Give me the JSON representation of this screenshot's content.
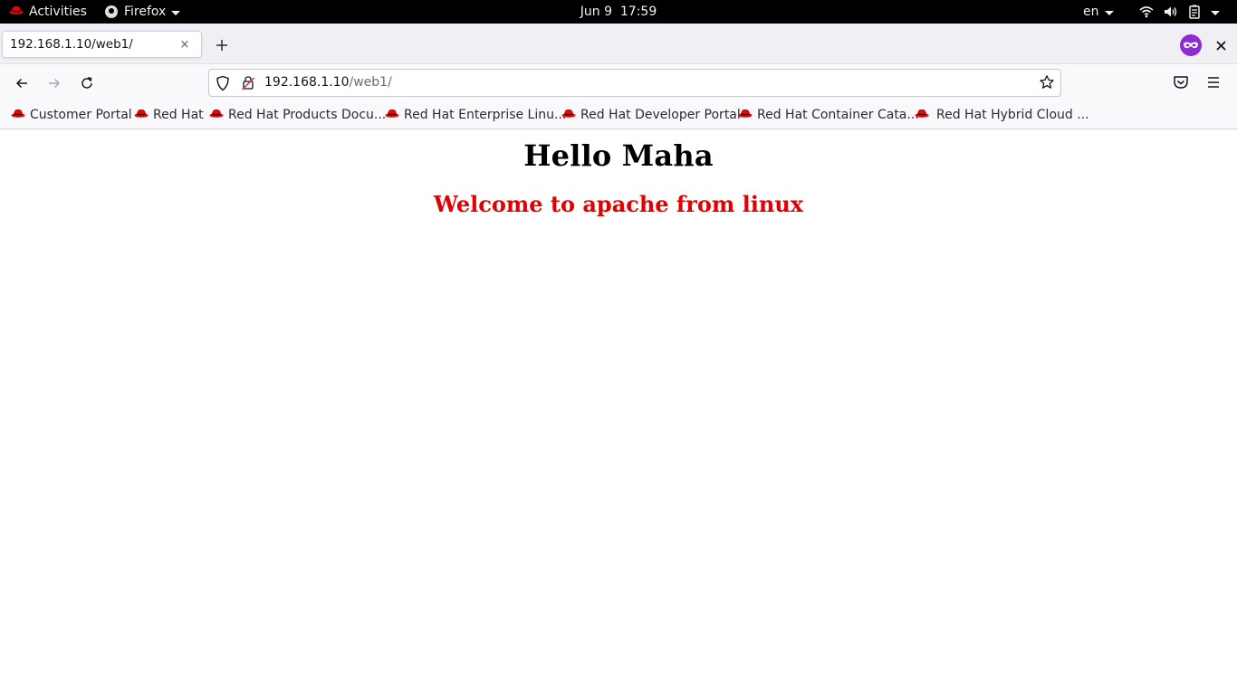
{
  "topbar": {
    "activities": "Activities",
    "app_name": "Firefox",
    "clock": "Jun 9  17:59",
    "language": "en"
  },
  "tab": {
    "title": "192.168.1.10/web1/",
    "close": "×"
  },
  "urlbar": {
    "host": "192.168.1.10",
    "path": "/web1/"
  },
  "bookmarks": [
    {
      "label": "Customer Portal"
    },
    {
      "label": "Red Hat"
    },
    {
      "label": "Red Hat Products Docu..."
    },
    {
      "label": "Red Hat Enterprise Linu..."
    },
    {
      "label": "Red Hat Developer Portal"
    },
    {
      "label": "Red Hat Container Cata..."
    },
    {
      "label": "Red Hat Hybrid Cloud ..."
    }
  ],
  "page": {
    "heading": "Hello Maha",
    "subheading": "Welcome to apache from linux",
    "subheading_color": "#e00000"
  },
  "colors": {
    "redhat_red": "#ee0000",
    "private_purple": "#8b2cd6"
  }
}
